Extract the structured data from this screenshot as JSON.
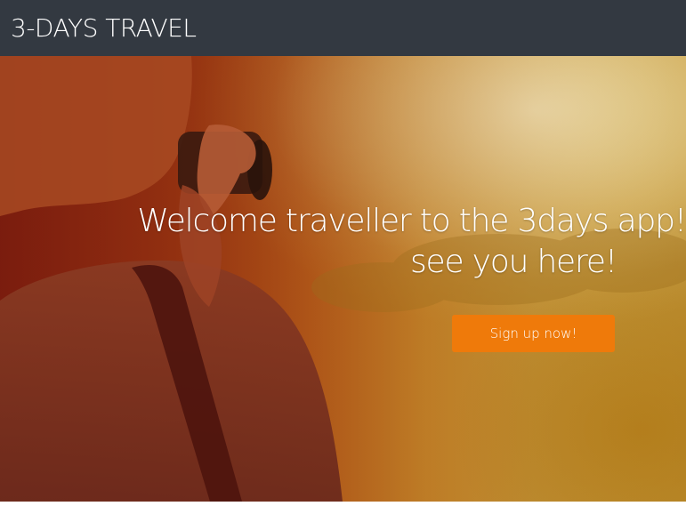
{
  "navbar": {
    "brand": "3-DAYS TRAVEL"
  },
  "hero": {
    "headline_line1": "Welcome traveller to the 3days app!",
    "headline_line2": "see you here!",
    "cta_label": "Sign up now!",
    "background_image": "photographer-with-camera-at-sunset",
    "colors": {
      "cta": "#ef7a0a",
      "navbar": "#333941",
      "text": "#ffffff"
    }
  }
}
